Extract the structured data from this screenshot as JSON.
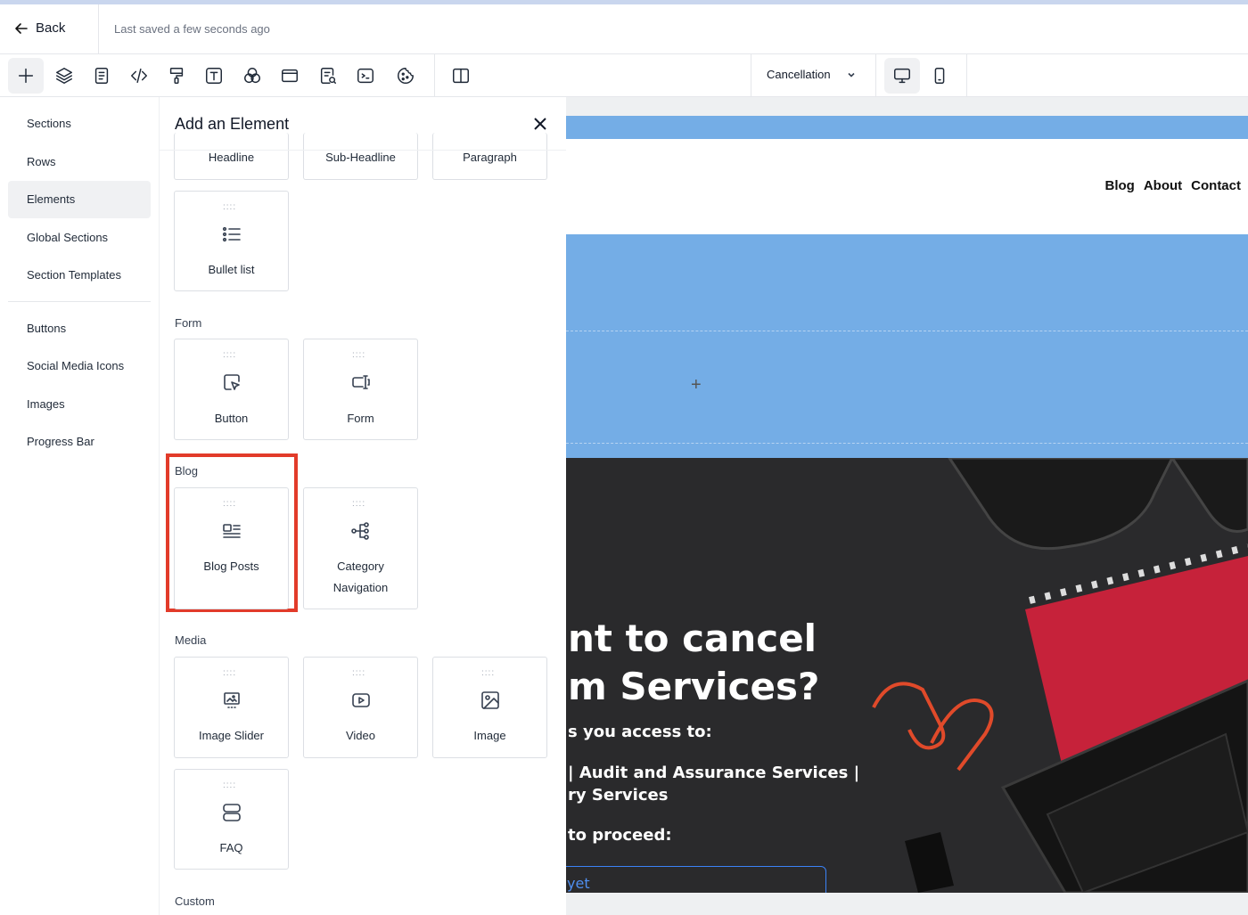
{
  "topbar": {
    "back_label": "Back",
    "saved_status": "Last saved a few seconds ago"
  },
  "toolbar": {
    "tools": [
      "add-icon",
      "layers-icon",
      "page-icon",
      "code-icon",
      "paint-roller-icon",
      "text-icon",
      "color-circles-icon",
      "browser-window-icon",
      "search-document-icon",
      "terminal-icon",
      "cookie-icon",
      "split-panel-icon"
    ],
    "page_selector": "Cancellation",
    "devices": [
      "desktop-icon",
      "mobile-icon"
    ]
  },
  "nav": {
    "items": [
      "Sections",
      "Rows",
      "Elements",
      "Global Sections",
      "Section Templates"
    ],
    "secondary_items": [
      "Buttons",
      "Social Media Icons",
      "Images",
      "Progress Bar"
    ],
    "active": "Elements"
  },
  "panel": {
    "title": "Add an Element",
    "top_cards": [
      "Headline",
      "Sub-Headline",
      "Paragraph"
    ],
    "text_cards": [
      "Bullet list"
    ],
    "groups": {
      "form": {
        "label": "Form",
        "cards": [
          "Button",
          "Form"
        ]
      },
      "blog": {
        "label": "Blog",
        "cards": [
          "Blog Posts",
          "Category",
          "Navigation"
        ]
      },
      "media": {
        "label": "Media",
        "cards": [
          "Image Slider",
          "Video",
          "Image",
          "FAQ"
        ]
      },
      "custom": {
        "label": "Custom"
      }
    }
  },
  "canvas": {
    "menu": [
      "Blog",
      "About",
      "Contact"
    ],
    "add_symbol": "+",
    "hero": {
      "line1": "nt to cancel",
      "line2": "m Services?",
      "line3": "s you access to:",
      "line4": "| Audit and Assurance Services |",
      "line5": "ry Services",
      "line6": "to proceed:",
      "button_text": "yet"
    },
    "colors": {
      "header_blue": "#74ade6",
      "hero_bg": "#2b2b2d",
      "highlight_red": "#e23b2a"
    }
  }
}
